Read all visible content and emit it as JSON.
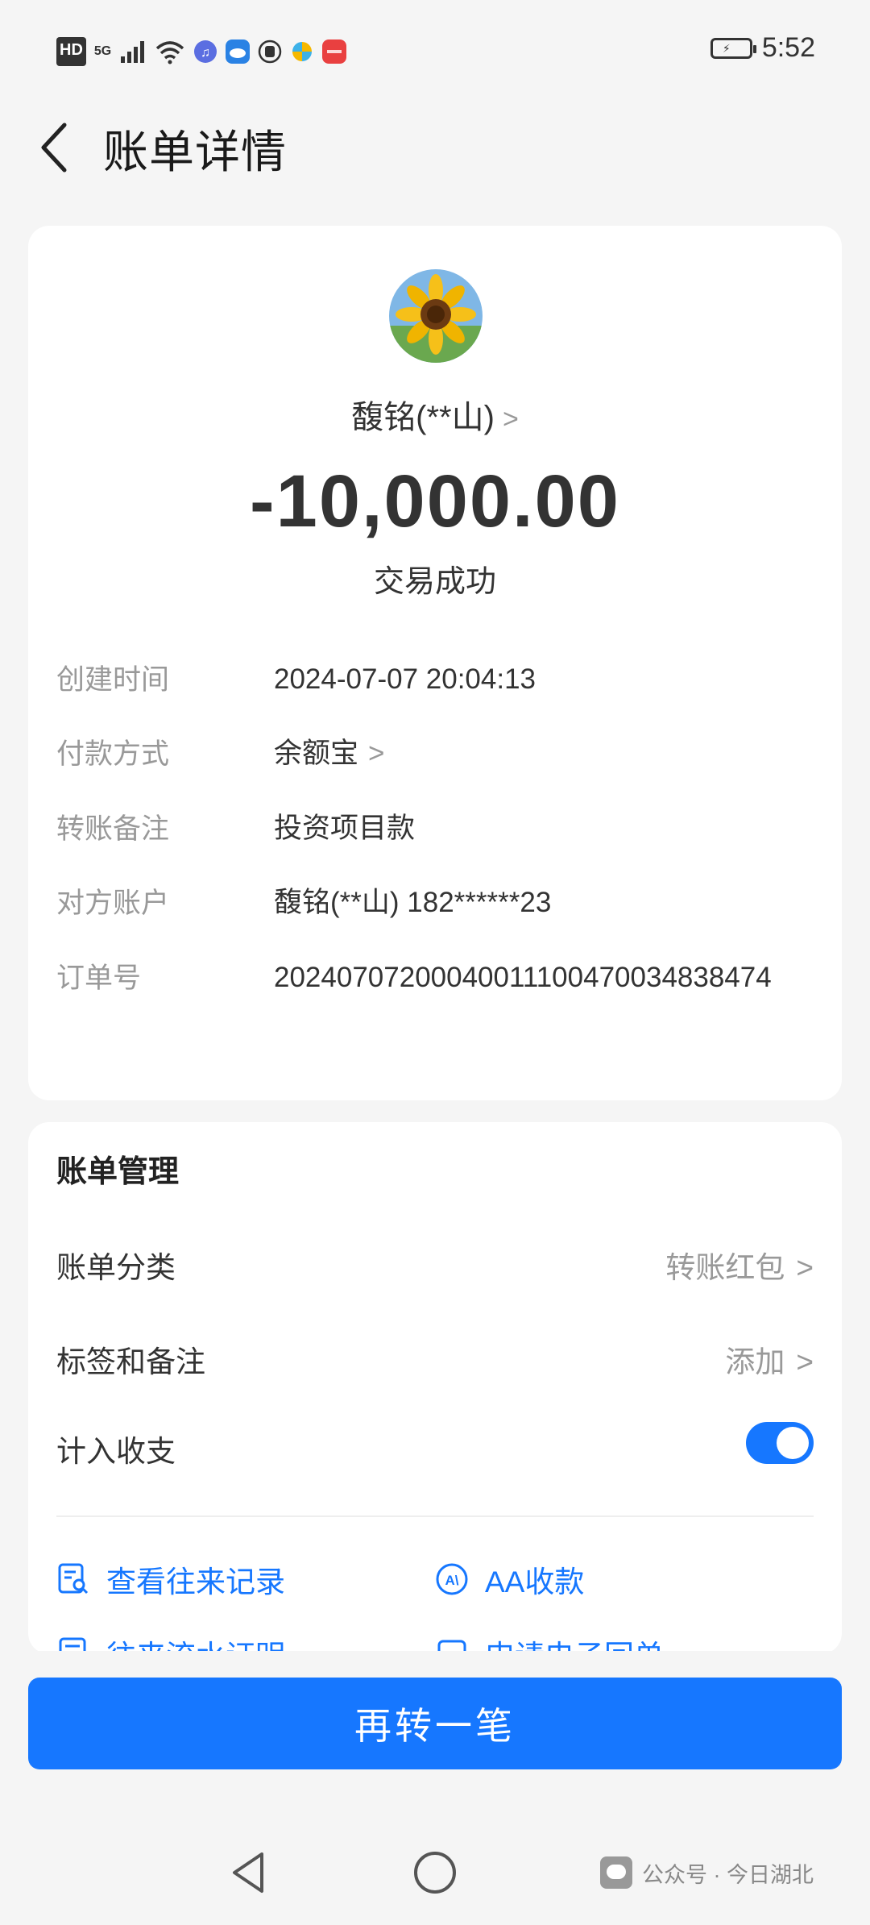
{
  "status_bar": {
    "network_badge": "HD",
    "network_type": "5G",
    "time": "5:52",
    "icons": [
      "hd-icon",
      "signal-icon",
      "wifi-icon",
      "music-app-icon",
      "cloud-app-icon",
      "shield-app-icon",
      "pinwheel-app-icon",
      "huawei-app-icon",
      "battery-icon"
    ]
  },
  "header": {
    "title": "账单详情",
    "back_icon": "chevron-left-icon"
  },
  "transaction": {
    "payee": "馥铭(**山)",
    "payee_chevron": ">",
    "amount": "-10,000.00",
    "status": "交易成功",
    "details": [
      {
        "label": "创建时间",
        "value": "2024-07-07 20:04:13"
      },
      {
        "label": "付款方式",
        "value": "余额宝",
        "chevron": ">"
      },
      {
        "label": "转账备注",
        "value": "投资项目款"
      },
      {
        "label": "对方账户",
        "value": "馥铭(**山) 182******23"
      },
      {
        "label": "订单号",
        "value": "20240707200040011100470034838474"
      }
    ]
  },
  "manage": {
    "title": "账单管理",
    "rows": [
      {
        "label": "账单分类",
        "value": "转账红包",
        "chevron": ">"
      },
      {
        "label": "标签和备注",
        "value": "添加",
        "chevron": ">"
      },
      {
        "label": "计入收支",
        "toggle_on": true
      }
    ],
    "links": [
      {
        "label": "查看往来记录",
        "icon": "record-search-icon"
      },
      {
        "label": "AA收款",
        "icon": "aa-icon"
      },
      {
        "label": "往来流水证明",
        "icon": "document-icon"
      },
      {
        "label": "申请电子回单",
        "icon": "receipt-icon"
      }
    ]
  },
  "action": {
    "primary_button": "再转一笔"
  },
  "nav_bar": {
    "icons": [
      "nav-back-icon",
      "nav-home-icon"
    ]
  },
  "watermark": {
    "text": "公众号 · 今日湖北"
  },
  "colors": {
    "accent": "#1677ff",
    "background": "#f5f5f5",
    "card": "#ffffff",
    "label_gray": "#999999"
  }
}
